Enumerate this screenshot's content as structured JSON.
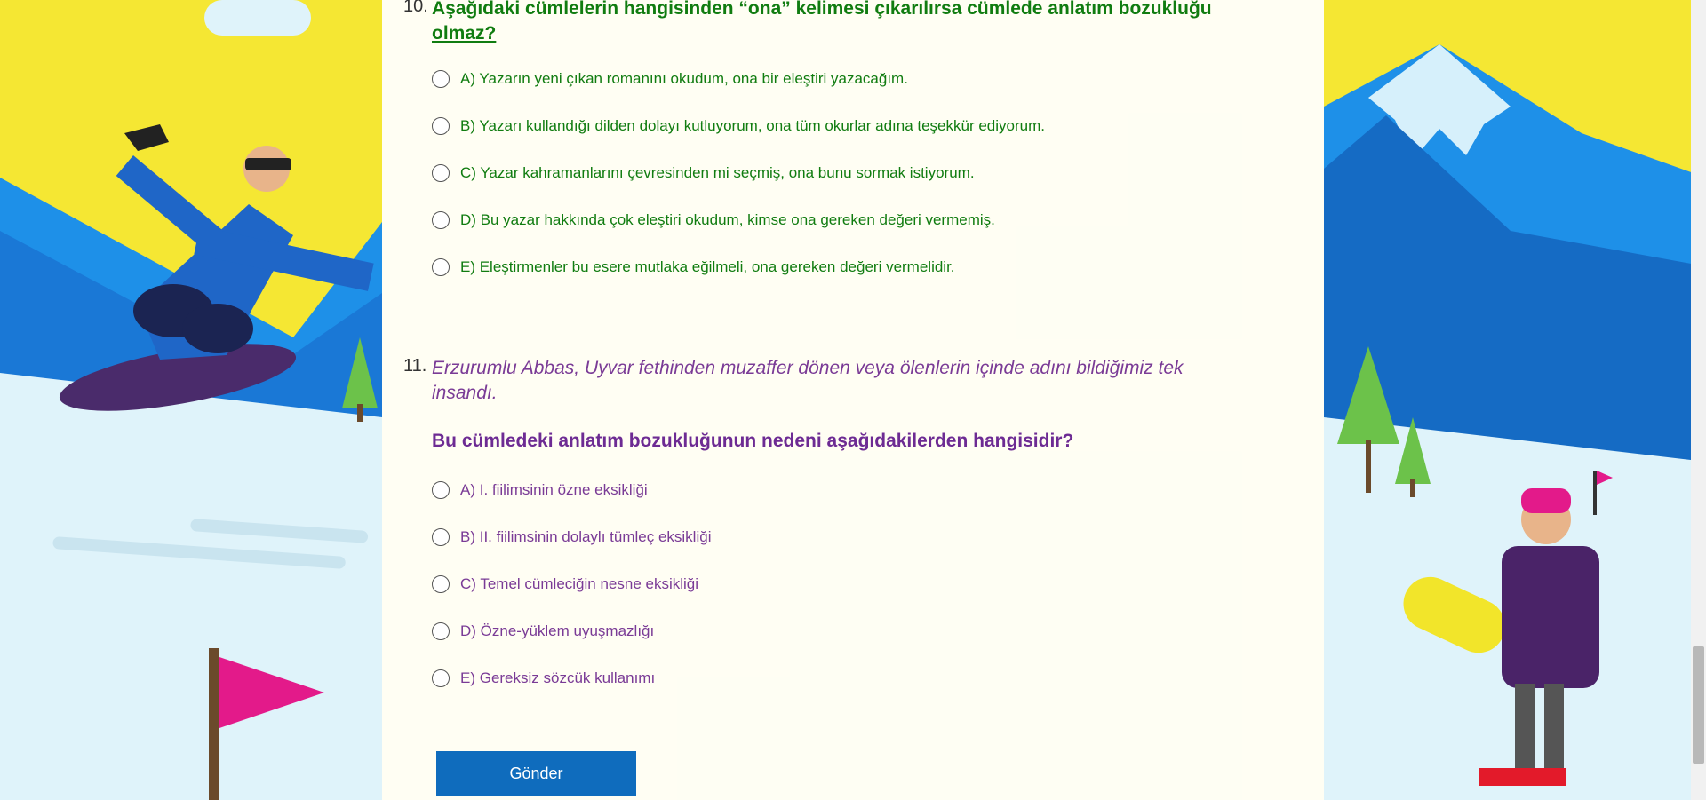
{
  "q10": {
    "number": "10.",
    "text_part1": "Aşağıdaki cümlelerin hangisinden “ona” kelimesi çıkarılırsa cümlede anlatım bozukluğu ",
    "text_underlined": "olmaz?",
    "options": [
      "A) Yazarın yeni çıkan romanını okudum, ona bir eleştiri yazacağım.",
      "B) Yazarı kullandığı dilden dolayı kutluyorum, ona tüm okurlar adına teşekkür ediyorum.",
      "C) Yazar kahramanlarını çevresinden mi seçmiş, ona bunu sormak istiyorum.",
      "D) Bu yazar hakkında çok eleştiri okudum, kimse ona gereken değeri vermemiş.",
      "E) Eleştirmenler bu esere mutlaka eğilmeli, ona gereken değeri vermelidir."
    ]
  },
  "q11": {
    "number": "11.",
    "stem": "Erzurumlu Abbas, Uyvar fethinden muzaffer dönen veya ölenlerin içinde adını bildiğimiz tek insandı.",
    "question": "Bu cümledeki anlatım bozukluğunun nedeni aşağıdakilerden hangisidir?",
    "options": [
      "A) I. fiilimsinin özne eksikliği",
      "B) II. fiilimsinin dolaylı tümleç eksikliği",
      "C) Temel cümleciğin nesne eksikliği",
      "D) Özne-yüklem uyuşmazlığı",
      "E) Gereksiz sözcük kullanımı"
    ]
  },
  "submit_label": "Gönder",
  "colors": {
    "q10_text": "#107c10",
    "q11_text": "#7a3b96",
    "submit_bg": "#0f6cbd",
    "sky_yellow": "#f5e733",
    "mountain_blue": "#1e90e8"
  }
}
